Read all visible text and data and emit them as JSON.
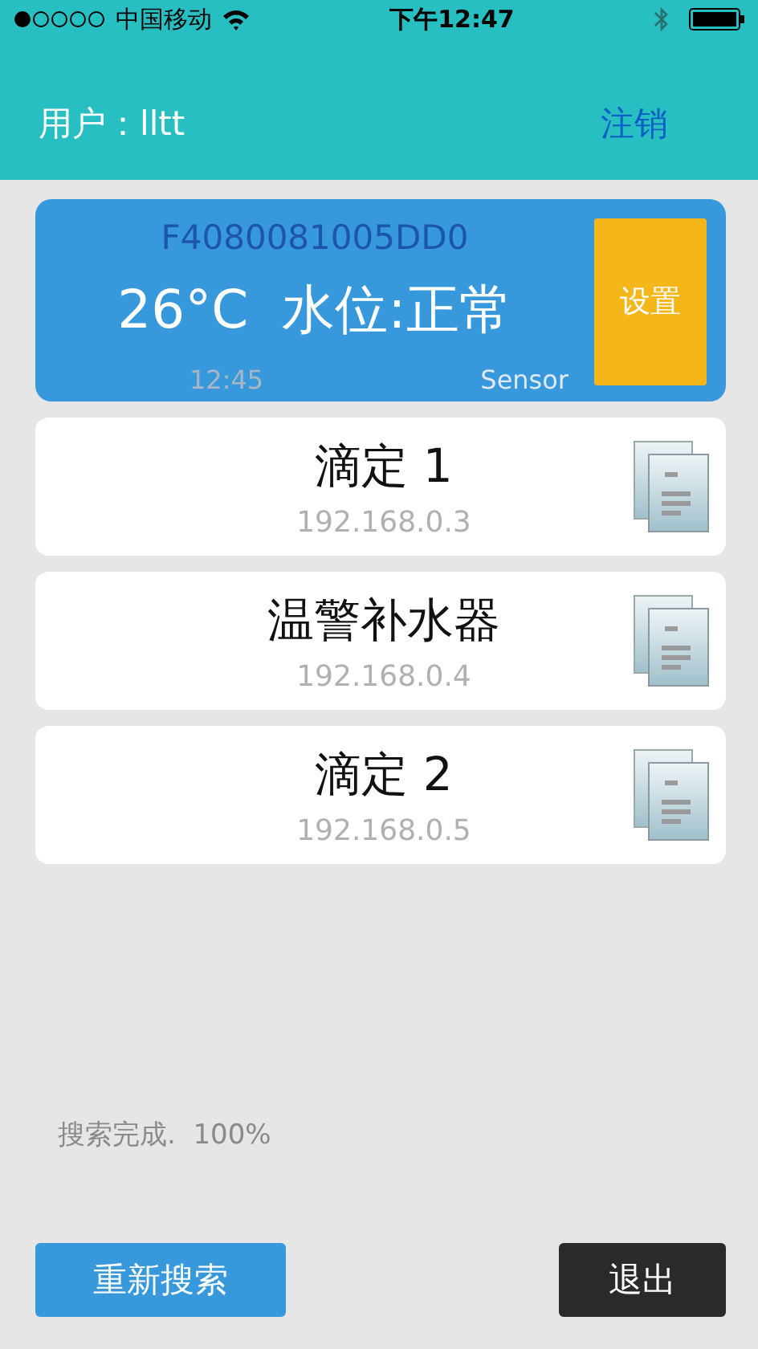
{
  "status_bar": {
    "carrier": "中国移动",
    "time": "下午12:47"
  },
  "header": {
    "user_label": "用户：",
    "user_name": "lltt",
    "logout": "注销"
  },
  "sensor_card": {
    "device_id": "F4080081005DD0",
    "reading": "26°C  水位:正常",
    "time": "12:45",
    "type": "Sensor",
    "settings_button": "设置"
  },
  "devices": [
    {
      "name": "滴定 1",
      "ip": "192.168.0.3"
    },
    {
      "name": "温警补水器",
      "ip": "192.168.0.4"
    },
    {
      "name": "滴定 2",
      "ip": "192.168.0.5"
    }
  ],
  "search_status": "搜索完成.  100%",
  "buttons": {
    "rescan": "重新搜索",
    "exit": "退出"
  }
}
